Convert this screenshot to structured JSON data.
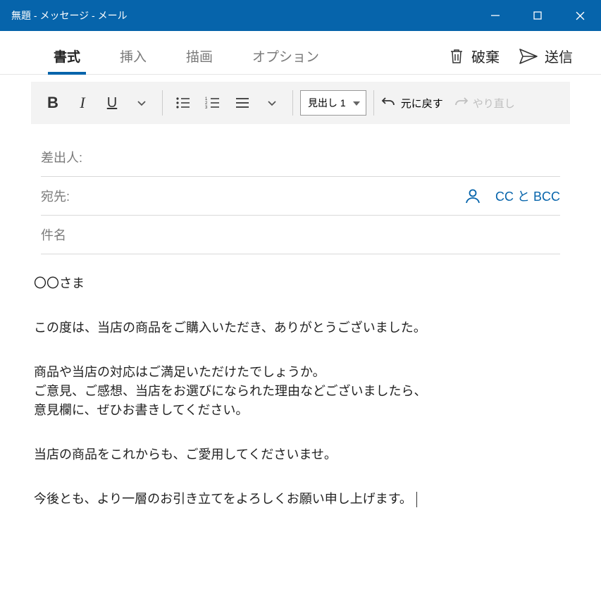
{
  "titlebar": {
    "title": "無題 - メッセージ - メール"
  },
  "tabs": {
    "format": "書式",
    "insert": "挿入",
    "draw": "描画",
    "options": "オプション"
  },
  "actions": {
    "discard": "破棄",
    "send": "送信"
  },
  "toolbar": {
    "heading": "見出し 1",
    "undo": "元に戻す",
    "redo": "やり直し"
  },
  "fields": {
    "from": "差出人:",
    "to": "宛先:",
    "subject": "件名",
    "ccbcc": "CC と BCC"
  },
  "body": {
    "l1": "〇〇さま",
    "l2": "この度は、当店の商品をご購入いただき、ありがとうございました。",
    "l3": "商品や当店の対応はご満足いただけたでしょうか。",
    "l4": "ご意見、ご感想、当店をお選びになられた理由などございましたら、",
    "l5": "意見欄に、ぜひお書きしてください。",
    "l6": "当店の商品をこれからも、ご愛用してくださいませ。",
    "l7": "今後とも、より一層のお引き立てをよろしくお願い申し上げます。"
  }
}
